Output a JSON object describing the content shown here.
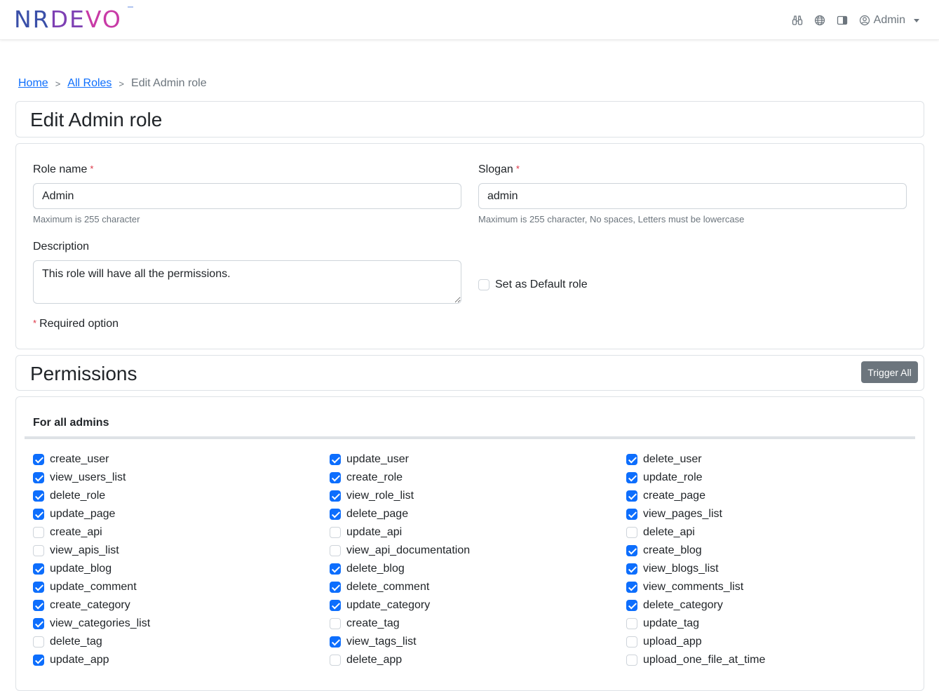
{
  "header": {
    "logo_parts": [
      "NR",
      "DE",
      "VO"
    ],
    "user_label": "Admin",
    "icons": [
      "binoculars-icon",
      "globe-icon",
      "sidebar-toggle-icon",
      "user-circle-icon"
    ]
  },
  "breadcrumb": {
    "home": "Home",
    "roles": "All Roles",
    "current": "Edit Admin role"
  },
  "page": {
    "title": "Edit Admin role"
  },
  "form": {
    "role_name_label": "Role name",
    "role_name_value": "Admin",
    "role_name_help": "Maximum is 255 character",
    "slogan_label": "Slogan",
    "slogan_value": "admin",
    "slogan_help": "Maximum is 255 character, No spaces, Letters must be lowercase",
    "description_label": "Description",
    "description_value": "This role will have all the permissions.",
    "default_role_label": "Set as Default role",
    "default_role_checked": false,
    "required_note": "Required option",
    "required_mark": "*"
  },
  "permissions": {
    "title": "Permissions",
    "trigger_all_label": "Trigger All",
    "group_title": "For all admins",
    "items": [
      {
        "name": "create_user",
        "checked": true
      },
      {
        "name": "update_user",
        "checked": true
      },
      {
        "name": "delete_user",
        "checked": true
      },
      {
        "name": "view_users_list",
        "checked": true
      },
      {
        "name": "create_role",
        "checked": true
      },
      {
        "name": "update_role",
        "checked": true
      },
      {
        "name": "delete_role",
        "checked": true
      },
      {
        "name": "view_role_list",
        "checked": true
      },
      {
        "name": "create_page",
        "checked": true
      },
      {
        "name": "update_page",
        "checked": true
      },
      {
        "name": "delete_page",
        "checked": true
      },
      {
        "name": "view_pages_list",
        "checked": true
      },
      {
        "name": "create_api",
        "checked": false
      },
      {
        "name": "update_api",
        "checked": false
      },
      {
        "name": "delete_api",
        "checked": false
      },
      {
        "name": "view_apis_list",
        "checked": false
      },
      {
        "name": "view_api_documentation",
        "checked": false
      },
      {
        "name": "create_blog",
        "checked": true
      },
      {
        "name": "update_blog",
        "checked": true
      },
      {
        "name": "delete_blog",
        "checked": true
      },
      {
        "name": "view_blogs_list",
        "checked": true
      },
      {
        "name": "update_comment",
        "checked": true
      },
      {
        "name": "delete_comment",
        "checked": true
      },
      {
        "name": "view_comments_list",
        "checked": true
      },
      {
        "name": "create_category",
        "checked": true
      },
      {
        "name": "update_category",
        "checked": true
      },
      {
        "name": "delete_category",
        "checked": true
      },
      {
        "name": "view_categories_list",
        "checked": true
      },
      {
        "name": "create_tag",
        "checked": false
      },
      {
        "name": "update_tag",
        "checked": false
      },
      {
        "name": "delete_tag",
        "checked": false
      },
      {
        "name": "view_tags_list",
        "checked": true
      },
      {
        "name": "upload_app",
        "checked": false
      },
      {
        "name": "update_app",
        "checked": true
      },
      {
        "name": "delete_app",
        "checked": false
      },
      {
        "name": "upload_one_file_at_time",
        "checked": false
      }
    ]
  },
  "colors": {
    "primary": "#0d6efd",
    "secondary_button": "#6c757d",
    "required": "#dc3545"
  }
}
